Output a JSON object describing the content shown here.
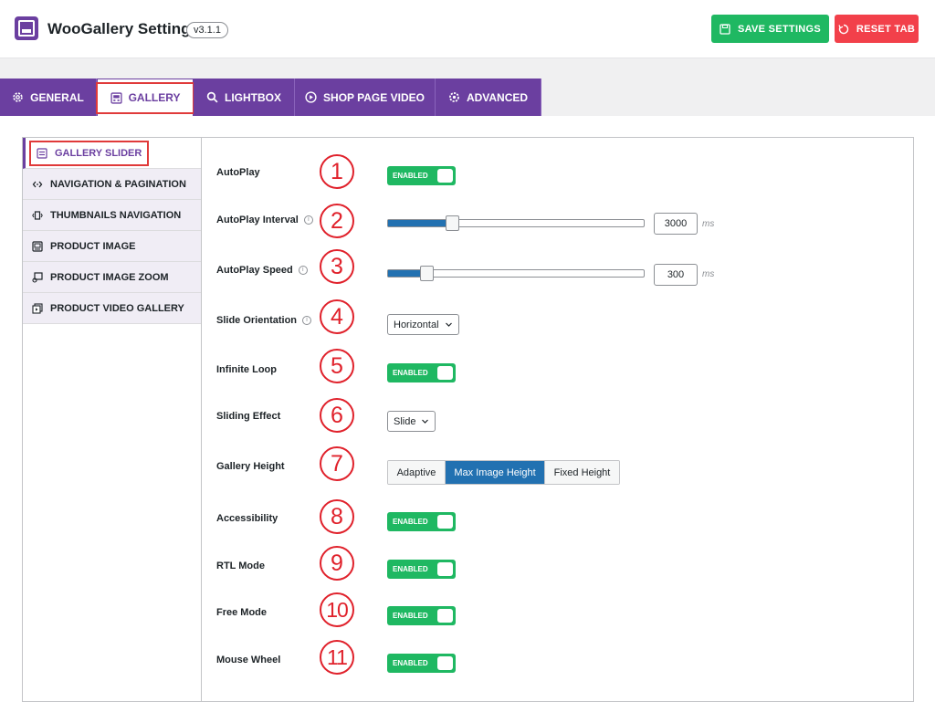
{
  "header": {
    "title": "WooGallery Settings",
    "version": "v3.1.1",
    "save_label": "SAVE SETTINGS",
    "reset_label": "RESET TAB"
  },
  "tabs": [
    {
      "label": "GENERAL",
      "icon": "gear-icon"
    },
    {
      "label": "GALLERY",
      "icon": "gallery-icon",
      "active": true
    },
    {
      "label": "LIGHTBOX",
      "icon": "search-icon"
    },
    {
      "label": "SHOP PAGE VIDEO",
      "icon": "play-icon"
    },
    {
      "label": "ADVANCED",
      "icon": "advanced-gear-icon"
    }
  ],
  "sidebar": {
    "items": [
      {
        "label": "GALLERY SLIDER",
        "icon": "slider-icon",
        "active": true
      },
      {
        "label": "NAVIGATION & PAGINATION",
        "icon": "navigation-arrows-icon"
      },
      {
        "label": "THUMBNAILS NAVIGATION",
        "icon": "thumbnails-icon"
      },
      {
        "label": "PRODUCT IMAGE",
        "icon": "image-icon"
      },
      {
        "label": "PRODUCT IMAGE ZOOM",
        "icon": "zoom-icon"
      },
      {
        "label": "PRODUCT VIDEO GALLERY",
        "icon": "video-icon"
      }
    ]
  },
  "settings": {
    "autoplay": {
      "label": "AutoPlay",
      "marker": "1",
      "state": "ENABLED"
    },
    "autoplay_interval": {
      "label": "AutoPlay Interval",
      "marker": "2",
      "value": "3000",
      "unit": "ms",
      "fraction": 0.25
    },
    "autoplay_speed": {
      "label": "AutoPlay Speed",
      "marker": "3",
      "value": "300",
      "unit": "ms",
      "fraction": 0.15
    },
    "slide_orientation": {
      "label": "Slide Orientation",
      "marker": "4",
      "value": "Horizontal"
    },
    "infinite_loop": {
      "label": "Infinite Loop",
      "marker": "5",
      "state": "ENABLED"
    },
    "sliding_effect": {
      "label": "Sliding Effect",
      "marker": "6",
      "value": "Slide"
    },
    "gallery_height": {
      "label": "Gallery Height",
      "marker": "7",
      "options": [
        "Adaptive",
        "Max Image Height",
        "Fixed Height"
      ],
      "selected": "Max Image Height"
    },
    "accessibility": {
      "label": "Accessibility",
      "marker": "8",
      "state": "ENABLED"
    },
    "rtl_mode": {
      "label": "RTL Mode",
      "marker": "9",
      "state": "ENABLED"
    },
    "free_mode": {
      "label": "Free Mode",
      "marker": "10",
      "state": "ENABLED"
    },
    "mouse_wheel": {
      "label": "Mouse Wheel",
      "marker": "11",
      "state": "ENABLED"
    }
  },
  "colors": {
    "brand_purple": "#6b3fa0",
    "enabled_green": "#1fb862",
    "reset_red": "#f2404a",
    "accent_blue": "#2271b1",
    "marker_red": "#e0212b"
  }
}
